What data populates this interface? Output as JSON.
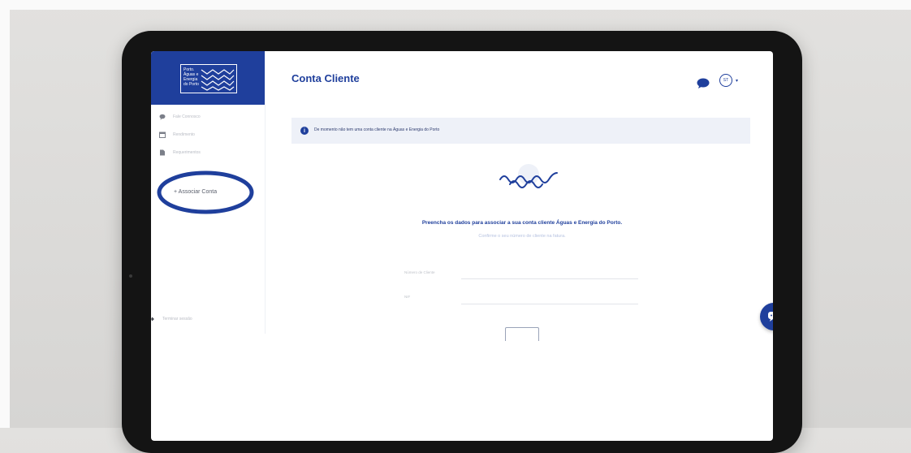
{
  "sidebar": {
    "logo_text": "Porto. Águas e Energia do Porto",
    "items": [
      {
        "label": "Fale Connosco",
        "icon": "chat-bubble-icon"
      },
      {
        "label": "Rendimento",
        "icon": "calendar-icon"
      },
      {
        "label": "Requerimentos",
        "icon": "document-icon"
      }
    ],
    "associar_label": "+ Associar Conta",
    "logout_label": "Terminar sessão"
  },
  "header": {
    "title": "Conta Cliente",
    "avatar_initials": "ST",
    "caret": "▾"
  },
  "info_bar": {
    "icon_text": "i",
    "message": "De momento não tem uma conta cliente na Águas e Energia do Porto"
  },
  "main": {
    "prompt": "Preencha os dados para associar a sua conta cliente Águas e Energia do Porto.",
    "subprompt": "Confirme o seu número de cliente na fatura.",
    "fields": [
      {
        "label": "Número de Cliente",
        "value": ""
      },
      {
        "label": "NIF",
        "value": ""
      }
    ]
  },
  "colors": {
    "brand_blue": "#1f3f9c",
    "info_bg": "#eef1f8",
    "muted_text": "#b9bcc4"
  }
}
